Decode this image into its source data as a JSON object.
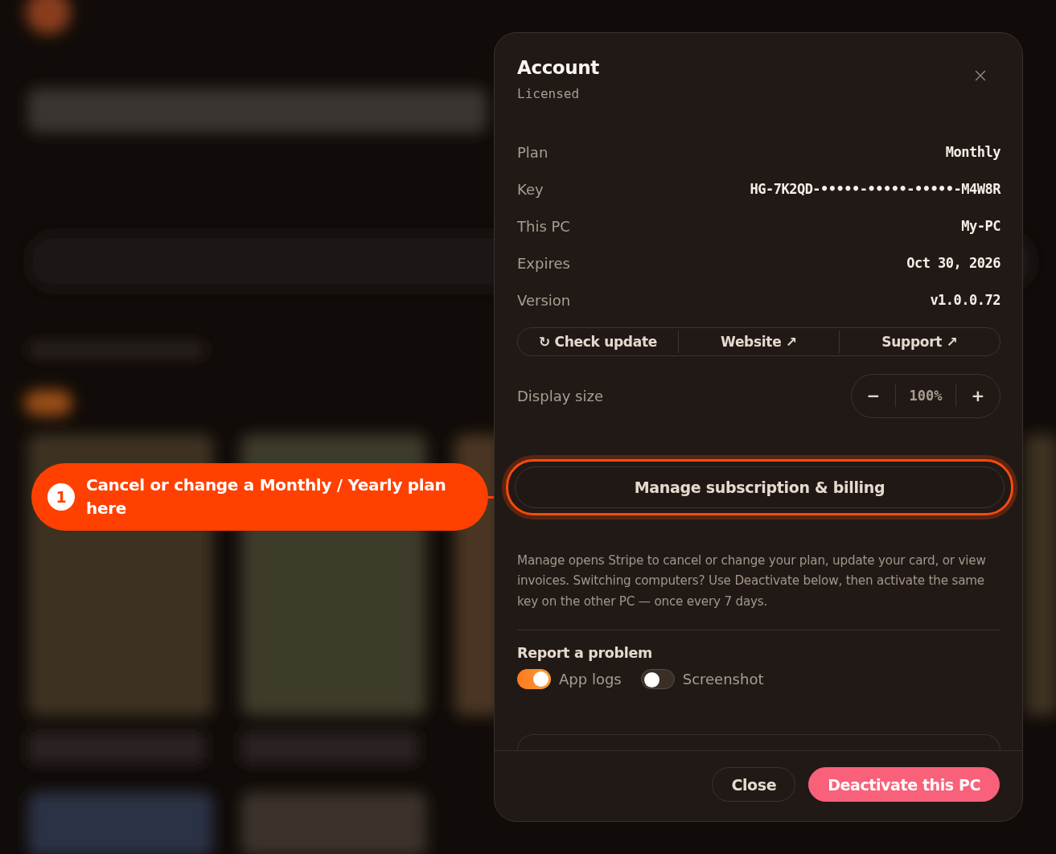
{
  "callout": {
    "number": "1",
    "text": "Cancel or change a Monthly / Yearly plan here"
  },
  "dialog": {
    "title": "Account",
    "status": "Licensed",
    "details": [
      {
        "label": "Plan",
        "value": "Monthly"
      },
      {
        "label": "Key",
        "value": "HG-7K2QD-•••••-•••••-•••••-M4W8R"
      },
      {
        "label": "This PC",
        "value": "My-PC"
      },
      {
        "label": "Expires",
        "value": "Oct 30, 2026"
      },
      {
        "label": "Version",
        "value": "v1.0.0.72"
      }
    ],
    "links": [
      "↻ Check update",
      "Website ↗",
      "Support ↗"
    ],
    "display_size": {
      "label": "Display size",
      "decrease": "−",
      "value": "100%",
      "increase": "+"
    },
    "manage": {
      "label": "Manage subscription & billing",
      "highlighted": true
    },
    "note": "Manage opens Stripe to cancel or change your plan, update your card, or view invoices. Switching computers? Use Deactivate below, then activate the same key on the other PC — once every 7 days.",
    "report": {
      "title": "Report a problem",
      "options": [
        {
          "label": "App logs",
          "on": true
        },
        {
          "label": "Screenshot",
          "on": false
        }
      ]
    },
    "footer_buttons": [
      {
        "label": "Close",
        "kind": "secondary"
      },
      {
        "label": "Deactivate this PC",
        "kind": "danger"
      }
    ]
  }
}
